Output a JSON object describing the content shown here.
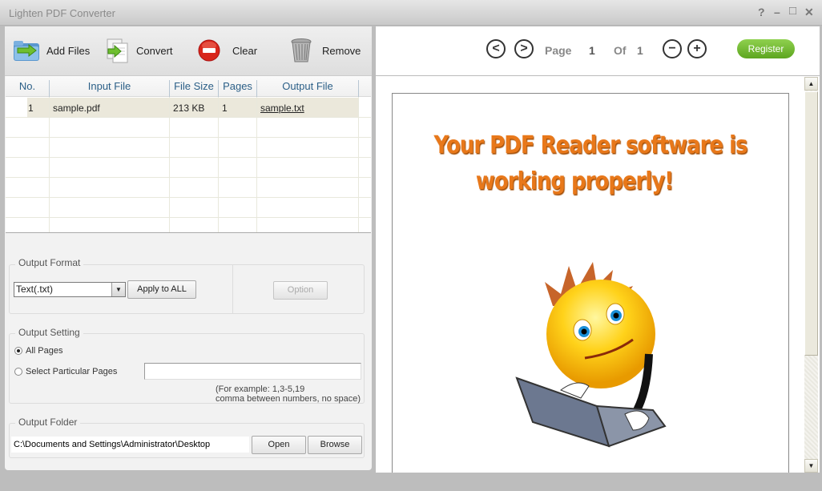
{
  "window": {
    "title": "Lighten PDF Converter",
    "controls": {
      "help": "?",
      "minimize": "–",
      "maximize": "□",
      "close": "✕"
    }
  },
  "toolbar": {
    "add_files": {
      "label": "Add Files",
      "icon": "folder-add-icon"
    },
    "convert": {
      "label": "Convert",
      "icon": "convert-document-icon"
    },
    "clear": {
      "label": "Clear",
      "icon": "clear-minus-icon"
    },
    "remove": {
      "label": "Remove",
      "icon": "trash-bin-icon"
    }
  },
  "file_table": {
    "columns": [
      "No.",
      "Input File",
      "File Size",
      "Pages",
      "Output File"
    ],
    "rows": [
      {
        "no": "1",
        "input_file": "sample.pdf",
        "file_size": "213 KB",
        "pages": "1",
        "output_file": "sample.txt"
      }
    ]
  },
  "output_format": {
    "legend": "Output Format",
    "selected": "Text(.txt)",
    "apply_all_label": "Apply to ALL",
    "option_label": "Option"
  },
  "output_setting": {
    "legend": "Output Setting",
    "all_pages_label": "All Pages",
    "all_pages_selected": true,
    "particular_pages_label": "Select Particular Pages",
    "particular_pages_value": "",
    "hint_line1": "(For example: 1,3-5,19",
    "hint_line2": "comma between numbers, no space)"
  },
  "output_folder": {
    "legend": "Output Folder",
    "path": "C:\\Documents and Settings\\Administrator\\Desktop",
    "open_label": "Open",
    "browse_label": "Browse"
  },
  "viewer": {
    "prev_icon": "<",
    "next_icon": ">",
    "page_label": "Page",
    "current_page": "1",
    "of_label": "Of",
    "total_pages": "1",
    "zoom_out_icon": "−",
    "zoom_in_icon": "+",
    "register_label": "Register",
    "register_color": "#6cb52e",
    "document": {
      "headline_line1": "Your PDF Reader software is",
      "headline_line2": "working properly!",
      "headline_color": "#e8781a",
      "illustration": "smiley-with-laptop"
    }
  },
  "scrollbar": {
    "up": "▲",
    "down": "▼"
  }
}
